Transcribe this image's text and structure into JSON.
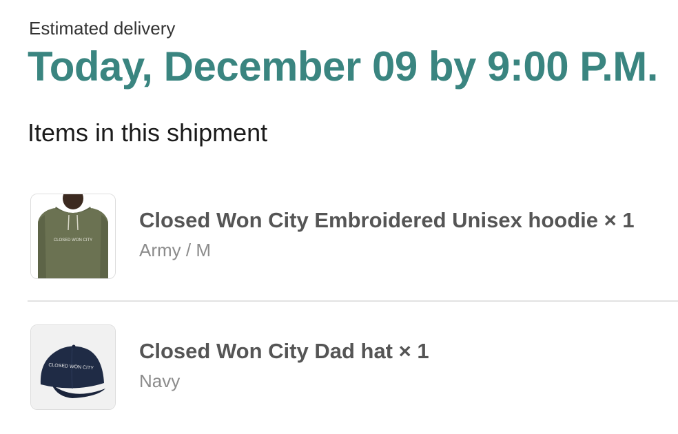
{
  "delivery": {
    "label": "Estimated delivery",
    "date": "Today, December 09 by 9:00 P.M."
  },
  "shipment": {
    "title": "Items in this shipment",
    "items": [
      {
        "name": "Closed Won City Embroidered Unisex hoodie × 1",
        "variant": "Army / M",
        "image_text": "CLOSED WON CITY",
        "image": "army-green-hoodie-photo"
      },
      {
        "name": "Closed Won City Dad hat × 1",
        "variant": "Navy",
        "image_text": "CLOSED WON CITY",
        "image": "navy-dad-hat-photo"
      }
    ]
  },
  "colors": {
    "accent": "#3a8580",
    "hoodie": "#6b7252",
    "hat": "#1f2b45"
  }
}
